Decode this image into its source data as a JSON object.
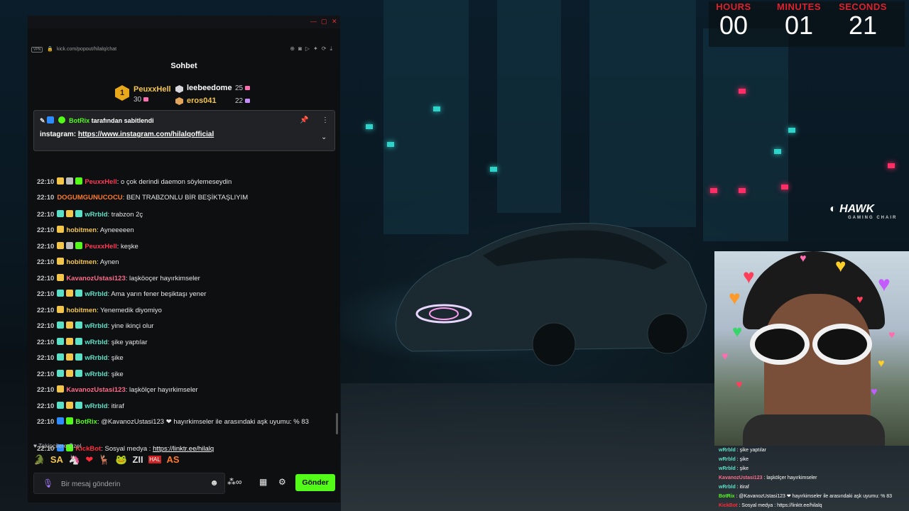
{
  "timer": {
    "hours_label": "HOURS",
    "hours": "00",
    "minutes_label": "MINUTES",
    "minutes": "01",
    "seconds_label": "SECONDS",
    "seconds": "21"
  },
  "overlay_logo": {
    "name": "HAWK",
    "sub": "GAMING CHAIR"
  },
  "browser": {
    "url": "kick.com/popout/hilalq/chat",
    "vpn": "VPN"
  },
  "chat": {
    "title": "Sohbet",
    "gifters": [
      {
        "rank": "1",
        "name": "PeuxxHell",
        "count": "30"
      },
      {
        "name": "leebeedome",
        "count": "25"
      },
      {
        "name": "eros041",
        "count": "22"
      }
    ],
    "pinned": {
      "by_user": "BotRix",
      "by_text": "tarafından sabitlendi",
      "prefix": "instagram: ",
      "link": "https://www.instagram.com/hilalqofficial"
    },
    "messages": [
      {
        "time": "22:10",
        "user": "PeuxxHell",
        "color": "#ff3a57",
        "text": ": o çok derindi daemon söylemeseydin"
      },
      {
        "time": "22:10",
        "user": "DOGUMGUNUCOCU",
        "color": "#ff7a2a",
        "text": ": BEN TRABZONLU BİR BEŞİKTAŞLIYIM"
      },
      {
        "time": "22:10",
        "user": "wRrbld",
        "color": "#5be0c7",
        "text": ": trabzon 2ç"
      },
      {
        "time": "22:10",
        "user": "hobitmen",
        "color": "#f3c64a",
        "text": ": Ayneeeeen"
      },
      {
        "time": "22:10",
        "user": "PeuxxHell",
        "color": "#ff3a57",
        "text": ": keşke"
      },
      {
        "time": "22:10",
        "user": "hobitmen",
        "color": "#f3c64a",
        "text": ": Aynen"
      },
      {
        "time": "22:10",
        "user": "KavanozUstasi123",
        "color": "#ff6b8a",
        "text": ": laşköoçer hayırkimseler"
      },
      {
        "time": "22:10",
        "user": "wRrbld",
        "color": "#5be0c7",
        "text": ": Ama yarın fener beşiktaşı yener"
      },
      {
        "time": "22:10",
        "user": "hobitmen",
        "color": "#f3c64a",
        "text": ": Yenemedik diyomiyo"
      },
      {
        "time": "22:10",
        "user": "wRrbld",
        "color": "#5be0c7",
        "text": ": yine ikinçi olur"
      },
      {
        "time": "22:10",
        "user": "wRrbld",
        "color": "#5be0c7",
        "text": ": şike yaptılar"
      },
      {
        "time": "22:10",
        "user": "wRrbld",
        "color": "#5be0c7",
        "text": ": şike"
      },
      {
        "time": "22:10",
        "user": "wRrbld",
        "color": "#5be0c7",
        "text": ": şike"
      },
      {
        "time": "22:10",
        "user": "KavanozUstasi123",
        "color": "#ff6b8a",
        "text": ": laşkölçer hayırkimseler"
      },
      {
        "time": "22:10",
        "user": "wRrbld",
        "color": "#5be0c7",
        "text": ": itiraf"
      },
      {
        "time": "22:10",
        "user": "BotRix",
        "color": "#53fc18",
        "text": ": @KavanozUstasi123 ❤ hayırkimseler ile arasındaki aşk uyumu: % 83"
      },
      {
        "time": "22:10",
        "user": "KickBot",
        "color": "#ff2b3a",
        "text": ": Sosyal medya : ",
        "link": "https://linktr.ee/hilalq"
      }
    ],
    "followers_only": "Takipçilere Özel",
    "input_placeholder": "Bir mesaj gönderin",
    "send_label": "Gönder"
  },
  "overlay_chat": [
    {
      "user": "wRrbld",
      "text": " : şike yaptılar"
    },
    {
      "user": "wRrbld",
      "text": " : şike"
    },
    {
      "user": "wRrbld",
      "text": " : şike"
    },
    {
      "user": "KavanozUstasi123",
      "text": " : laşkölçer hayırkimseler"
    },
    {
      "user": "wRrbld",
      "text": " : itiraf"
    },
    {
      "user": "BotRix",
      "text": " : @KavanozUstasi123 ❤ hayırkimseler ile arasındaki aşk uyumu: % 83"
    },
    {
      "user": "KickBot",
      "text": " : Sosyal medya : https://linktr.ee/hilalq"
    }
  ]
}
